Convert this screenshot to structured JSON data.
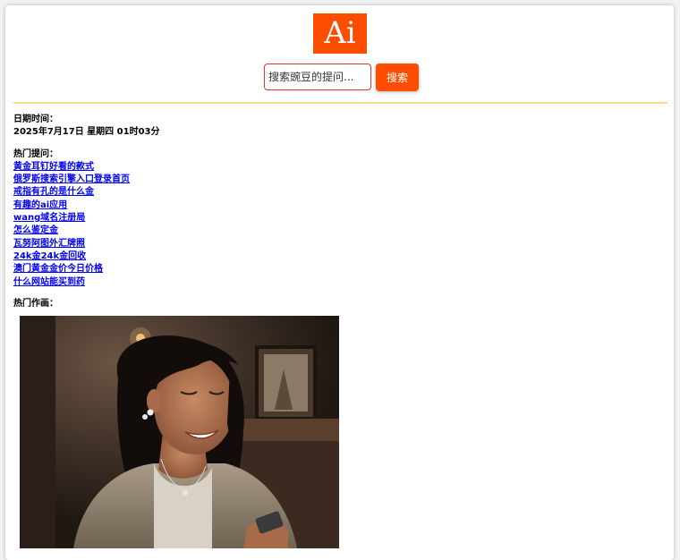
{
  "logo": {
    "text": "Ai",
    "color": "#ff4d00"
  },
  "search": {
    "placeholder": "搜索豌豆的提问...",
    "button_label": "搜索"
  },
  "datetime": {
    "label": "日期时间：",
    "value": "2025年7月17日 星期四 01时03分"
  },
  "hot_questions": {
    "label": "热门提问：",
    "items": [
      "黄金耳钉好看的款式",
      "俄罗斯搜索引擎入口登录首页",
      "戒指有孔的是什么金",
      "有趣的ai应用",
      "wang域名注册局",
      "怎么鉴定金",
      "瓦努阿图外汇牌照",
      "24k金24k金回收",
      "澳门黄金金价今日价格",
      "什么网站能买到药"
    ]
  },
  "hot_paintings": {
    "label": "热门作画："
  },
  "colors": {
    "accent": "#ff4d00",
    "divider": "#ffd68a",
    "link": "#0000ee"
  }
}
